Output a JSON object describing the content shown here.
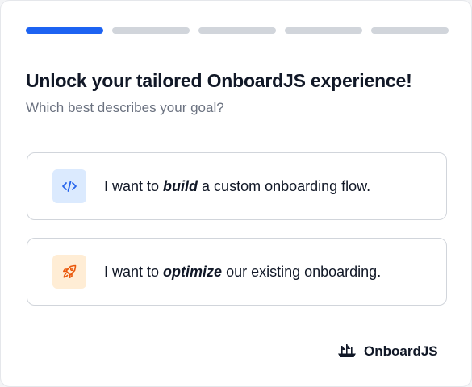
{
  "progress": {
    "total_steps": 5,
    "current_step": 1
  },
  "header": {
    "title": "Unlock your tailored OnboardJS experience!",
    "subtitle": "Which best describes your goal?"
  },
  "options": [
    {
      "icon": "code-icon",
      "prefix": "I want to ",
      "emphasis": "build",
      "suffix": " a custom onboarding flow."
    },
    {
      "icon": "rocket-icon",
      "prefix": "I want to ",
      "emphasis": "optimize",
      "suffix": " our existing onboarding."
    }
  ],
  "brand": {
    "name": "OnboardJS",
    "icon": "ship-logo-icon"
  },
  "colors": {
    "accent": "#1d63f2",
    "inactive": "#d1d5db",
    "code_icon": "#2563eb",
    "rocket_icon": "#ea580c"
  }
}
